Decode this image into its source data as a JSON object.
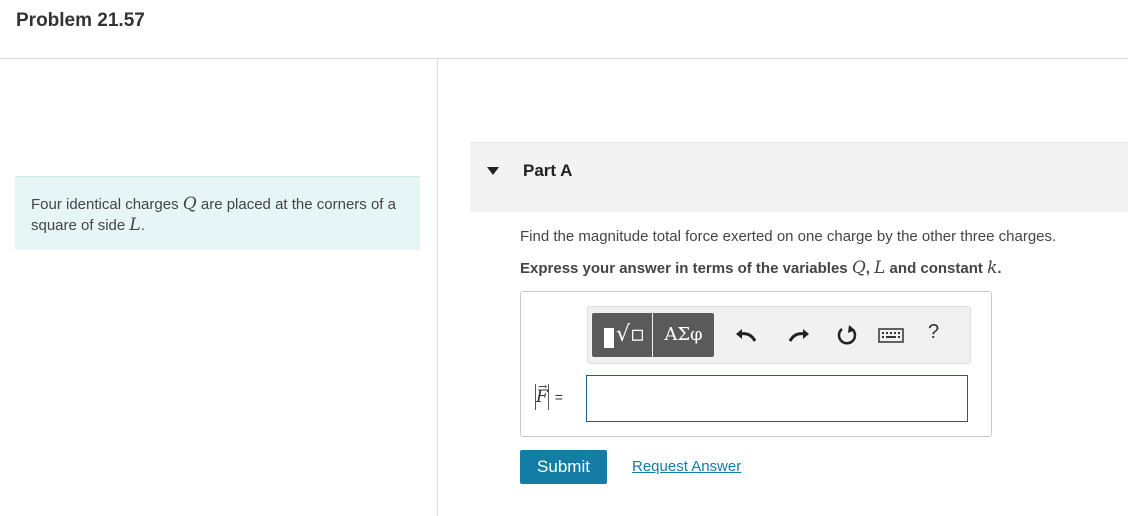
{
  "page_title": "Problem 21.57",
  "problem": {
    "text_before_q": "Four identical charges ",
    "var_q": "Q",
    "text_middle": " are placed at the corners of a square of side ",
    "var_l": "L",
    "text_end": "."
  },
  "part": {
    "label": "Part A",
    "question": "Find the magnitude total force exerted on one charge by the other three charges.",
    "instruction_prefix": "Express your answer in terms of the variables ",
    "var_q": "Q",
    "sep": ", ",
    "var_l": "L",
    "instruction_mid": " and constant ",
    "var_k": "k",
    "instruction_end": "."
  },
  "toolbar": {
    "greek_label": "ΑΣφ",
    "help_label": "?",
    "icons": [
      "templates-icon",
      "greek-letters-icon",
      "undo-icon",
      "redo-icon",
      "reset-icon",
      "keyboard-icon",
      "help-icon"
    ]
  },
  "answer": {
    "lhs_var": "F",
    "lhs_eq": "=",
    "value": ""
  },
  "actions": {
    "submit_label": "Submit",
    "request_label": "Request Answer"
  },
  "colors": {
    "accent": "#137da6",
    "problem_bg": "#e6f5f6",
    "part_header_bg": "#f3f3f3",
    "input_border": "#1a5e86"
  }
}
